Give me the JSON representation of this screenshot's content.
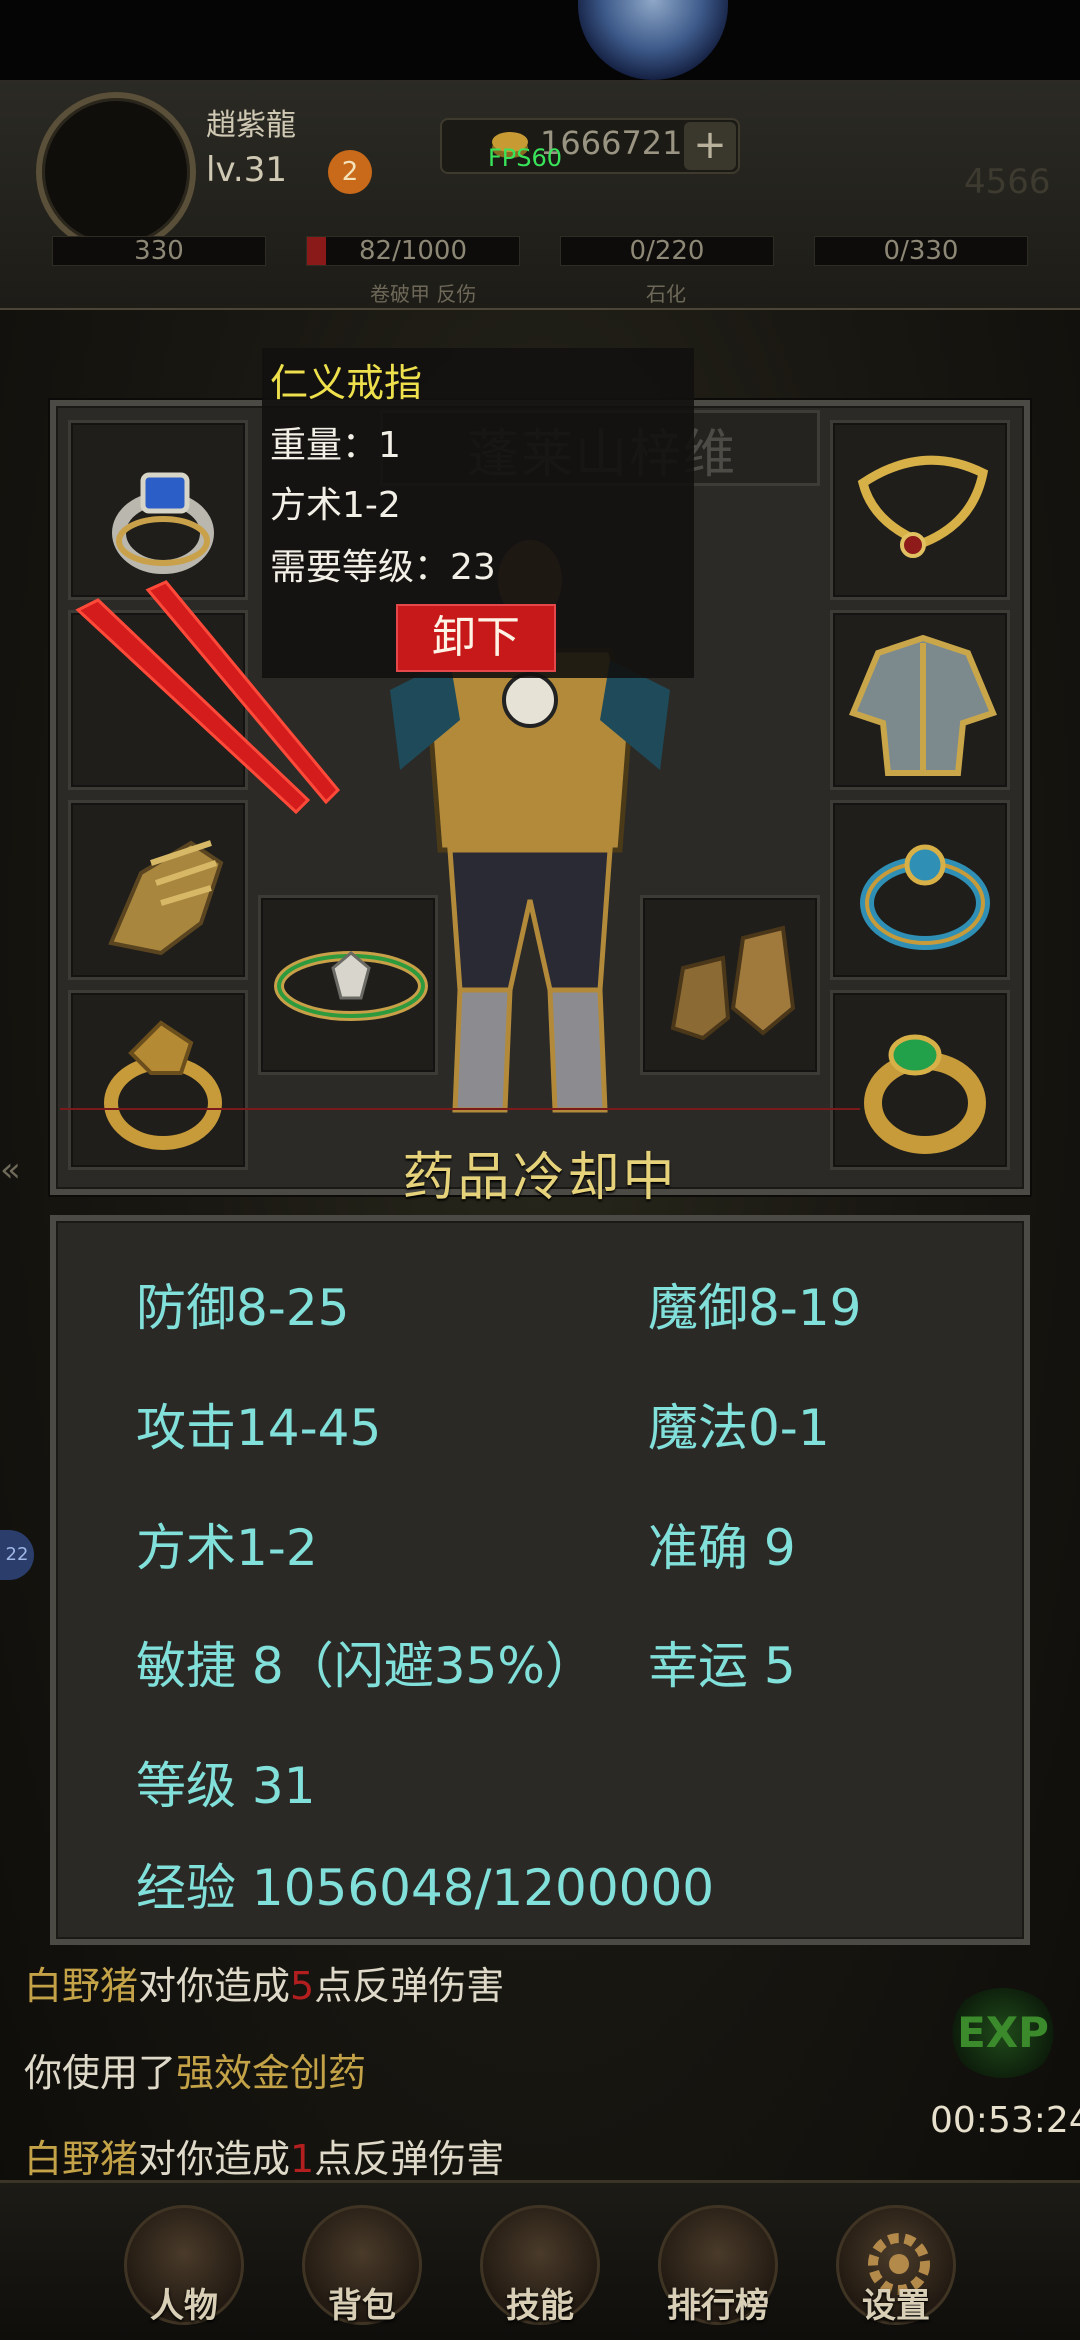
{
  "header": {
    "player_name": "趙紫龍",
    "level": "lv.31",
    "level_badge": "2",
    "gold": "1666721",
    "plus": "+",
    "fps": "FPS60",
    "power": "4566",
    "bars": [
      {
        "value": "330"
      },
      {
        "value": "82/1000",
        "sub": "卷破甲 反伤"
      },
      {
        "value": "0/220",
        "sub": "石化"
      },
      {
        "value": "0/330"
      }
    ]
  },
  "equipment": {
    "character_name": "蓬莱山梓维",
    "cooldown_text": "药品冷却中",
    "slots_left": [
      "ring-blue-gem-icon",
      "red-twin-swords-icon",
      "gold-gauntlet-icon",
      "dragon-ring-icon"
    ],
    "slots_right": [
      "gold-necklace-icon",
      "gold-armor-icon",
      "blue-ring-icon",
      "jade-ring-icon"
    ],
    "slots_bottom": [
      "green-bracelet-icon",
      "boots-icon"
    ]
  },
  "tooltip": {
    "item_name": "仁义戒指",
    "weight": "重量：1",
    "stat": "方术1-2",
    "required_level": "需要等级：23",
    "unequip_label": "卸下"
  },
  "stats": {
    "defense": "防御8-25",
    "magic_defense": "魔御8-19",
    "attack": "攻击14-45",
    "magic": "魔法0-1",
    "taoism": "方术1-2",
    "accuracy": "准确 9",
    "agility": "敏捷 8（闪避35%）",
    "luck": "幸运 5",
    "level": "等级 31",
    "exp": "经验 1056048/1200000"
  },
  "chat": {
    "line1_mob": "白野猪",
    "line1_a": "对你造成",
    "line1_num": "5",
    "line1_b": "点反弹伤害",
    "line2_a": "你使用了",
    "line2_item": "强效金创药",
    "line3_mob": "白野猪",
    "line3_a": "对你造成",
    "line3_num": "1",
    "line3_b": "点反弹伤害",
    "timer": "00:53:24",
    "exp_orb": "EXP",
    "side_badge": "22"
  },
  "nav": {
    "items": [
      "人物",
      "背包",
      "技能",
      "排行榜",
      "设置"
    ]
  }
}
